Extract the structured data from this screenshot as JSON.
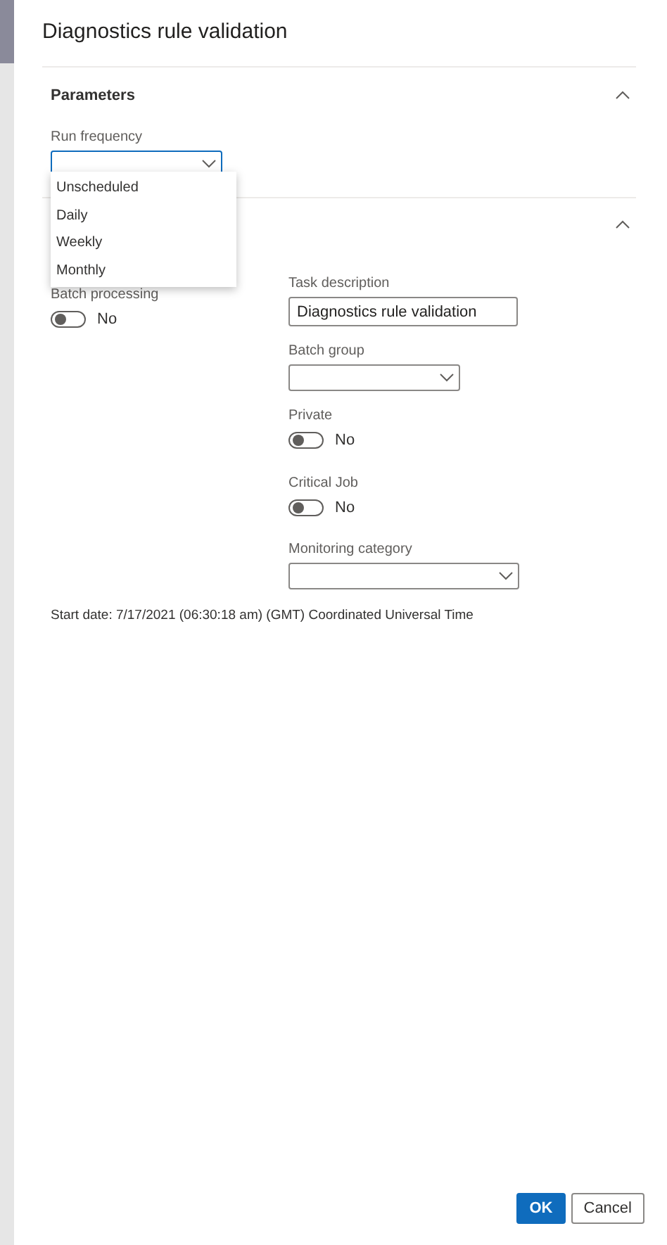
{
  "dialog": {
    "title": "Diagnostics rule validation"
  },
  "parameters": {
    "title": "Parameters",
    "expanded": true,
    "run_frequency": {
      "label": "Run frequency",
      "open": true,
      "options": [
        {
          "label": "Unscheduled"
        },
        {
          "label": "Daily"
        },
        {
          "label": "Weekly"
        },
        {
          "label": "Monthly"
        }
      ]
    }
  },
  "run_in_background": {
    "expanded": true,
    "batch_processing": {
      "label": "Batch processing",
      "on": false,
      "state_text": "No"
    },
    "task_description": {
      "label": "Task description",
      "value": "Diagnostics rule validation"
    },
    "batch_group": {
      "label": "Batch group"
    },
    "private": {
      "label": "Private",
      "on": false,
      "state_text": "No"
    },
    "critical_job": {
      "label": "Critical Job",
      "on": false,
      "state_text": "No"
    },
    "monitoring_category": {
      "label": "Monitoring category"
    },
    "start_date": "Start date: 7/17/2021 (06:30:18 am) (GMT) Coordinated Universal Time"
  },
  "buttons": [
    {
      "label": "OK",
      "kind": "primary"
    },
    {
      "label": "Cancel",
      "kind": "secondary"
    }
  ]
}
